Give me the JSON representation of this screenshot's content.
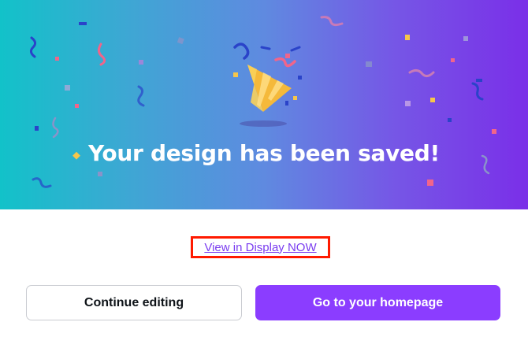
{
  "dialog": {
    "title": "Your design has been saved!",
    "link_label": "View in Display NOW",
    "secondary_button": "Continue editing",
    "primary_button": "Go to your homepage"
  },
  "colors": {
    "gradient_start": "#12c2c9",
    "gradient_end": "#7a2fe8",
    "primary_button_bg": "#8b3dff",
    "link_color": "#7a3cf0",
    "highlight_border": "#ff1a00"
  },
  "icons": {
    "illustration": "party-popper-icon"
  }
}
